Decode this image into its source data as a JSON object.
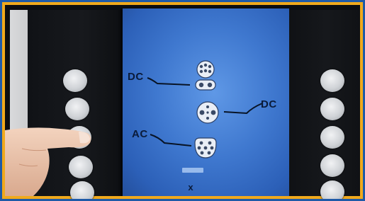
{
  "screen": {
    "header_text": "",
    "labels": {
      "dc_top": "DC",
      "dc_right": "DC",
      "ac": "AC"
    },
    "close_glyph": "x"
  },
  "icons": {
    "connector_top": "dc-charging-connector-icon",
    "connector_middle": "dc-charging-connector-icon",
    "connector_bottom": "ac-charging-connector-icon"
  },
  "colors": {
    "frame": "#f0a91c",
    "screen": "#3f78cf",
    "bezel": "#111317",
    "button": "#d6d9dc"
  }
}
